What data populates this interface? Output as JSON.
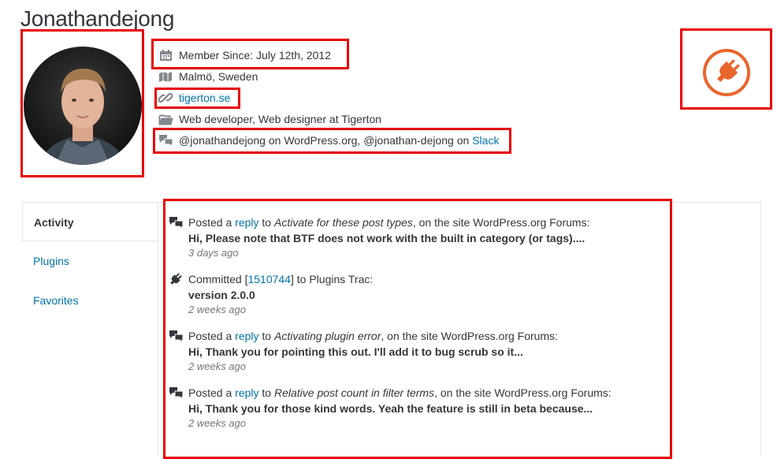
{
  "profile": {
    "name": "Jonathandejong",
    "member_since": "Member Since: July 12th, 2012",
    "location": "Malmö, Sweden",
    "website": "tigerton.se",
    "job": "Web developer, Web designer at Tigerton",
    "handles_prefix": "@jonathandejong on WordPress.org, @jonathan-dejong on ",
    "handles_link": "Slack"
  },
  "tabs": [
    {
      "label": "Activity",
      "active": true
    },
    {
      "label": "Plugins",
      "active": false
    },
    {
      "label": "Favorites",
      "active": false
    }
  ],
  "activity": [
    {
      "icon": "forum-icon",
      "prefix": "Posted a ",
      "link": "reply",
      "mid": " to ",
      "topic": "Activate for these post types",
      "suffix": ", on the site WordPress.org Forums:",
      "excerpt": "Hi, Please note that BTF does not work with the built in category (or tags)....",
      "time": "3 days ago"
    },
    {
      "icon": "plugin-icon",
      "prefix": "Committed [",
      "link": "1510744",
      "suffix": "] to Plugins Trac:",
      "excerpt": "version 2.0.0",
      "time": "2 weeks ago"
    },
    {
      "icon": "forum-icon",
      "prefix": "Posted a ",
      "link": "reply",
      "mid": " to ",
      "topic": "Activating plugin error",
      "suffix": ", on the site WordPress.org Forums:",
      "excerpt": "Hi, Thank you for pointing this out. I'll add it to bug scrub so it...",
      "time": "2 weeks ago"
    },
    {
      "icon": "forum-icon",
      "prefix": "Posted a ",
      "link": "reply",
      "mid": " to ",
      "topic": "Relative post count in filter terms",
      "suffix": ", on the site WordPress.org Forums:",
      "excerpt": "Hi, Thank you for those kind words. Yeah the feature is still in beta because...",
      "time": "2 weeks ago"
    }
  ],
  "colors": {
    "link": "#0073aa",
    "accent_orange": "#e9662c",
    "highlight_red": "#e60000"
  }
}
